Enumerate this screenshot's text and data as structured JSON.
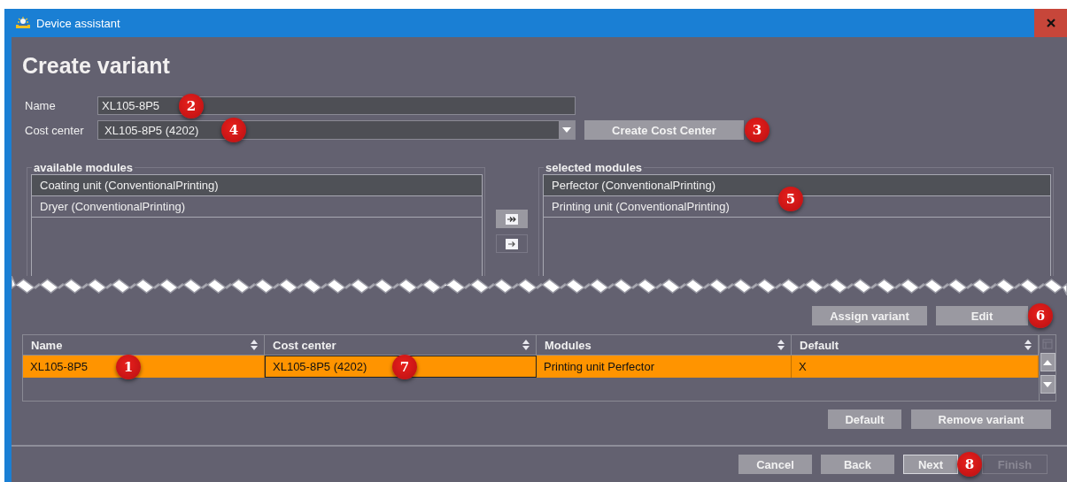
{
  "window": {
    "title": "Device assistant"
  },
  "heading": "Create variant",
  "form": {
    "name": {
      "label": "Name",
      "value": "XL105-8P5",
      "callout": "2"
    },
    "cost_center": {
      "label": "Cost center",
      "value": "XL105-8P5 (4202)",
      "callout": "4"
    },
    "create_button": {
      "label": "Create Cost Center",
      "callout": "3"
    }
  },
  "available_modules": {
    "title": "available modules",
    "items": [
      {
        "label": "Coating unit (ConventionalPrinting)",
        "selected": true
      },
      {
        "label": "Dryer (ConventionalPrinting)",
        "selected": false
      }
    ]
  },
  "transfer_buttons": [
    {
      "kind": "all"
    },
    {
      "kind": "one"
    }
  ],
  "selected_modules": {
    "title": "selected modules",
    "callout": "5",
    "items": [
      {
        "label": "Perfector (ConventionalPrinting)",
        "selected": true
      },
      {
        "label": "Printing unit (ConventionalPrinting)",
        "selected": false
      }
    ]
  },
  "variant_actions": [
    {
      "label": "Assign variant"
    },
    {
      "label": "Edit",
      "callout": "6"
    }
  ],
  "table": {
    "columns": [
      "Name",
      "Cost center",
      "Modules",
      "Default"
    ],
    "rows": [
      {
        "selected": true,
        "cells": [
          {
            "text": "XL105-8P5",
            "callout": "1",
            "focused": false
          },
          {
            "text": "XL105-8P5 (4202)",
            "callout": "7",
            "focused": true
          },
          {
            "text": "Printing unit Perfector",
            "focused": false
          },
          {
            "text": "X",
            "focused": false
          }
        ]
      }
    ]
  },
  "table_actions": [
    {
      "label": "Default"
    },
    {
      "label": "Remove variant"
    }
  ],
  "footer": [
    {
      "label": "Cancel",
      "default": false,
      "disabled": false
    },
    {
      "label": "Back",
      "default": false,
      "disabled": false
    },
    {
      "label": "Next",
      "default": true,
      "disabled": false,
      "callout": "8"
    },
    {
      "label": "Finish",
      "default": false,
      "disabled": true
    }
  ]
}
